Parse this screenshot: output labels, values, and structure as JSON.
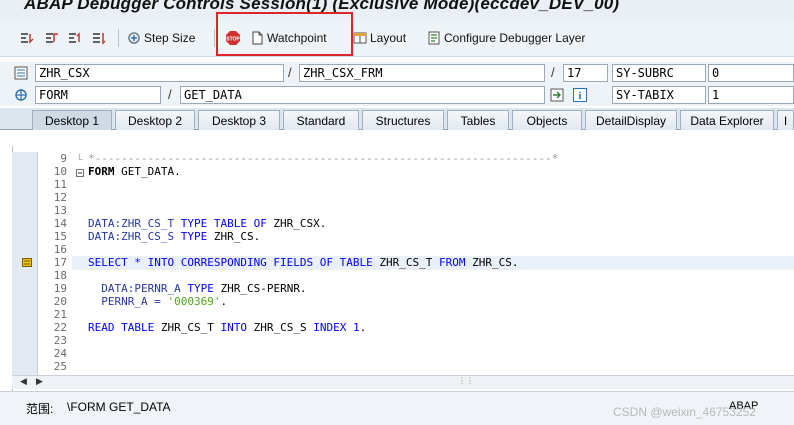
{
  "window": {
    "title": "ABAP Debugger Controls Session(1)  (Exclusive Mode)(eccdev_DEV_00)"
  },
  "toolbar": {
    "step_size": "Step Size",
    "watchpoint": "Watchpoint",
    "layout": "Layout",
    "configure_layer": "Configure Debugger Layer"
  },
  "info_row1": {
    "program": "ZHR_CSX",
    "include": "ZHR_CSX_FRM",
    "line": "17",
    "sysvar_name": "SY-SUBRC",
    "sysvar_value": "0"
  },
  "info_row2": {
    "event_type": "FORM",
    "event_name": "GET_DATA",
    "sysvar_name": "SY-TABIX",
    "sysvar_value": "1"
  },
  "tabs": [
    "Desktop 1",
    "Desktop 2",
    "Desktop 3",
    "Standard",
    "Structures",
    "Tables",
    "Objects",
    "DetailDisplay",
    "Data Explorer",
    "I"
  ],
  "editor": {
    "line_numbers": [
      "9",
      "10",
      "11",
      "12",
      "13",
      "14",
      "15",
      "16",
      "17",
      "18",
      "19",
      "20",
      "21",
      "22",
      "23",
      "24",
      "25"
    ],
    "comment_line": "*---------------------------------------------------------------------*",
    "l10_kw": "FORM",
    "l10_rest": " GET_DATA.",
    "l14_a": "DATA:ZHR_CS_T ",
    "l14_b": "TYPE TABLE OF",
    "l14_c": " ZHR_CSX.",
    "l15_a": "DATA:ZHR_CS_S ",
    "l15_b": "TYPE",
    "l15_c": " ZHR_CS.",
    "l17_a": "SELECT * INTO CORRESPONDING FIELDS OF TABLE",
    "l17_b": " ZHR_CS_T ",
    "l17_c": "FROM",
    "l17_d": " ZHR_CS.",
    "l19_a": "  DATA:PERNR_A ",
    "l19_b": "TYPE",
    "l19_c": " ZHR_CS-PERNR.",
    "l20_a": "  PERNR_A = ",
    "l20_b": "'000369'",
    "l20_c": ".",
    "l22_a": "READ TABLE",
    "l22_b": " ZHR_CS_T ",
    "l22_c": "INTO",
    "l22_d": " ZHR_CS_S ",
    "l22_e": "INDEX",
    "l22_f": " 1",
    "l22_g": "."
  },
  "status": {
    "scope_label": "范围:",
    "scope_value": "\\FORM GET_DATA",
    "language": "ABAP",
    "watermark": "CSDN @weixin_46753252"
  }
}
